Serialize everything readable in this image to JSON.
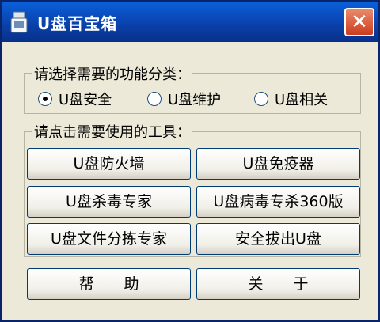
{
  "window": {
    "title": "U盘百宝箱",
    "close_label": "✕"
  },
  "category": {
    "label": "请选择需要的功能分类：",
    "options": [
      "U盘安全",
      "U盘维护",
      "U盘相关"
    ],
    "selected": "U盘安全"
  },
  "tools": {
    "label": "请点击需要使用的工具：",
    "buttons": [
      "U盘防火墙",
      "U盘免疫器",
      "U盘杀毒专家",
      "U盘病毒专杀360版",
      "U盘文件分拣专家",
      "安全拔出U盘"
    ]
  },
  "footer": {
    "help_label": "帮　　助",
    "about_label": "关　　于"
  },
  "icons": {
    "app": "usb-drive-icon",
    "close": "close-icon"
  }
}
